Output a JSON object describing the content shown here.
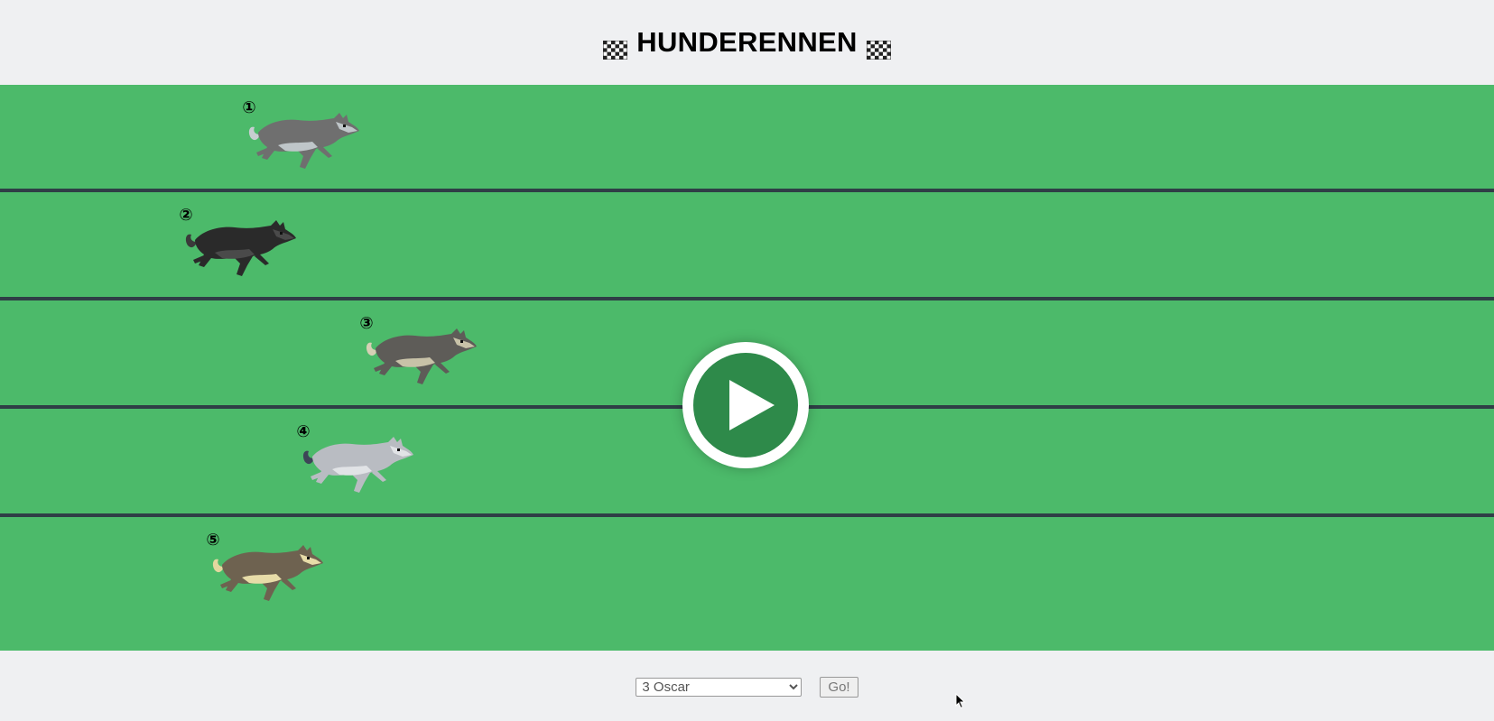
{
  "header": {
    "title": "HUNDERENNEN",
    "left_flag_icon": "checkered-flag-icon",
    "right_flag_icon": "checkered-flag-icon"
  },
  "track": {
    "color": "#4cba6a",
    "divider_color": "#2f3e46",
    "dogs": [
      {
        "number": "①",
        "body_color": "#6f6f6f",
        "belly_color": "#bfc6c9",
        "tail_color": "#c7ced1",
        "progress": 0.08
      },
      {
        "number": "②",
        "body_color": "#2a2a2a",
        "belly_color": "#4a4a4a",
        "tail_color": "#3a3a3a",
        "progress": 0.01
      },
      {
        "number": "③",
        "body_color": "#5e5c58",
        "belly_color": "#c8c2a8",
        "tail_color": "#d6d0b5",
        "progress": 0.21
      },
      {
        "number": "④",
        "body_color": "#b9bcc2",
        "belly_color": "#e1e3e6",
        "tail_color": "#3d4557",
        "progress": 0.14
      },
      {
        "number": "⑤",
        "body_color": "#6e6250",
        "belly_color": "#e7dca8",
        "tail_color": "#e2d79f",
        "progress": 0.04
      }
    ]
  },
  "play_button": {
    "icon": "play-icon",
    "fill": "#2e8a4a"
  },
  "controls": {
    "selected_dog": "3 Oscar",
    "go_label": "Go!"
  }
}
